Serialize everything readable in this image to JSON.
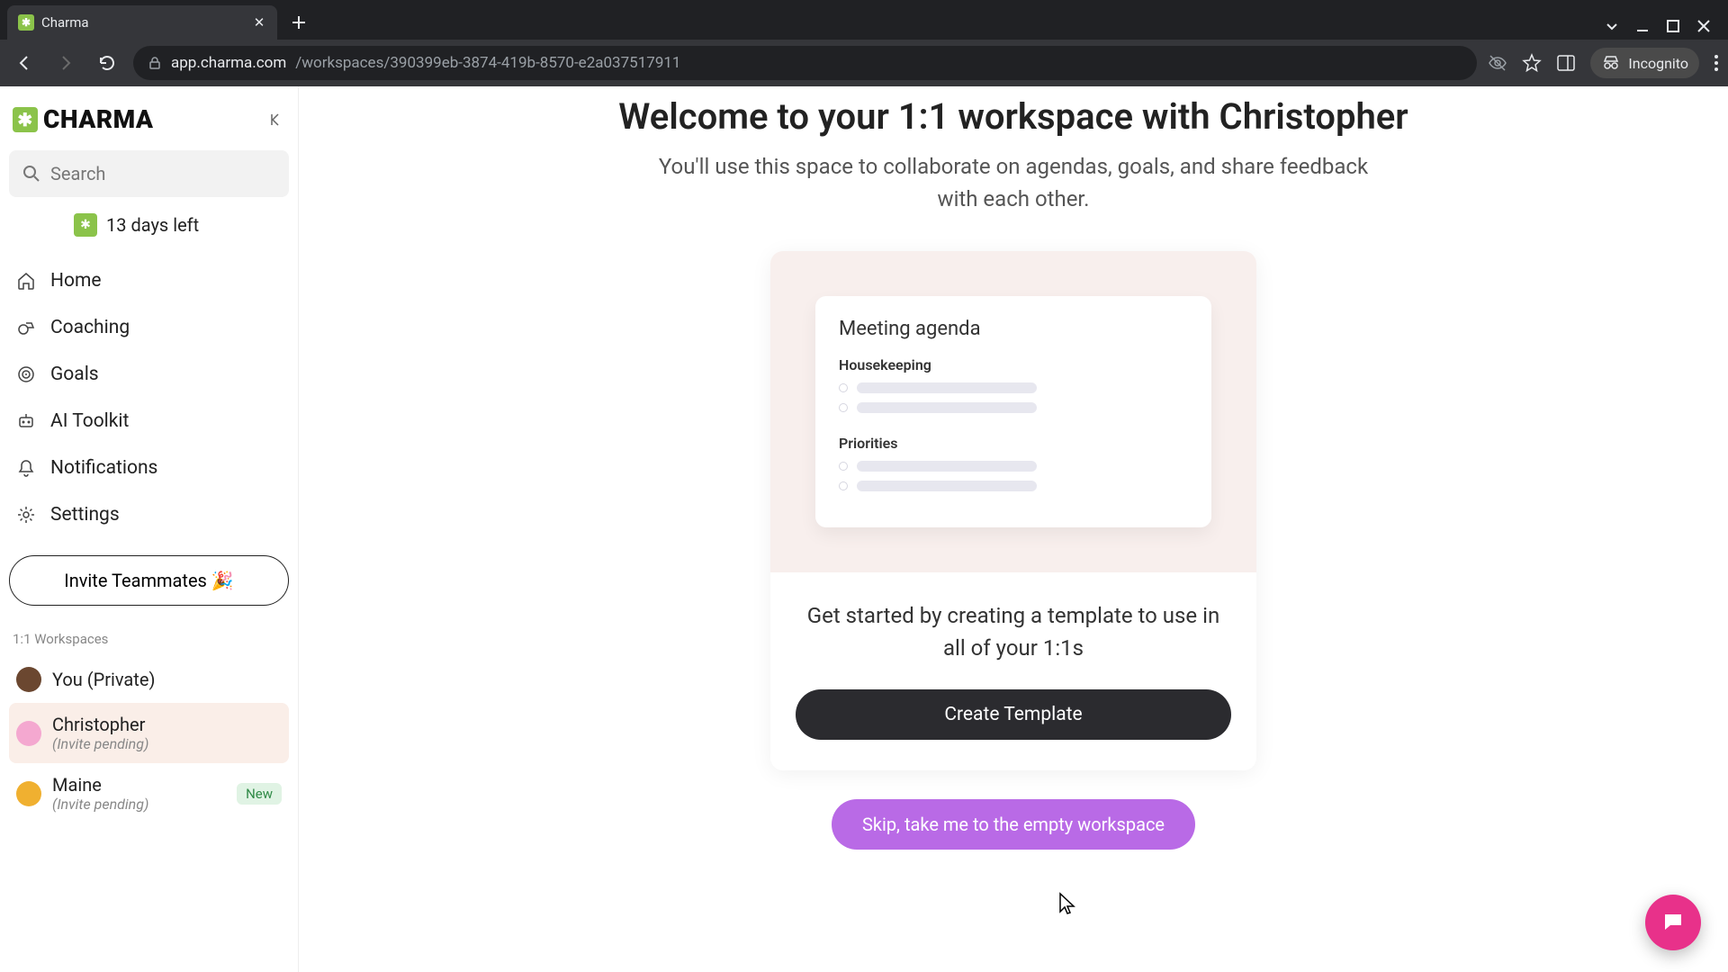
{
  "browser": {
    "tab_title": "Charma",
    "url_host": "app.charma.com",
    "url_path": "/workspaces/390399eb-3874-419b-8570-e2a037517911",
    "incognito_label": "Incognito"
  },
  "sidebar": {
    "brand": "CHARMA",
    "search_placeholder": "Search",
    "trial_label": "13 days left",
    "nav": [
      {
        "label": "Home"
      },
      {
        "label": "Coaching"
      },
      {
        "label": "Goals"
      },
      {
        "label": "AI Toolkit"
      },
      {
        "label": "Notifications"
      },
      {
        "label": "Settings"
      }
    ],
    "invite_label": "Invite Teammates 🎉",
    "ws_header": "1:1 Workspaces",
    "workspaces": [
      {
        "name": "You (Private)",
        "sub": "",
        "badge": ""
      },
      {
        "name": "Christopher",
        "sub": "(Invite pending)",
        "badge": ""
      },
      {
        "name": "Maine",
        "sub": "(Invite pending)",
        "badge": "New"
      }
    ]
  },
  "main": {
    "title": "Welcome to your 1:1 workspace with Christopher",
    "subtitle": "You'll use this space to collaborate on agendas, goals, and share feedback with each other.",
    "preview_title": "Meeting agenda",
    "section1": "Housekeeping",
    "section2": "Priorities",
    "lower_title": "Get started by creating a template to use in all of your 1:1s",
    "create_label": "Create Template",
    "skip_label": "Skip, take me to the empty workspace"
  }
}
